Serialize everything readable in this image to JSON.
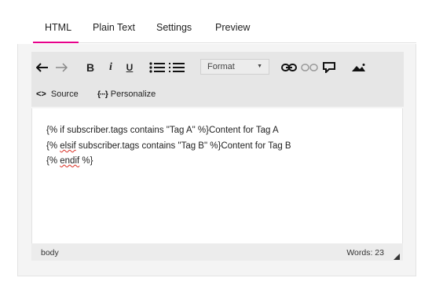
{
  "tabs": [
    {
      "label": "HTML"
    },
    {
      "label": "Plain Text"
    },
    {
      "label": "Settings"
    },
    {
      "label": "Preview"
    }
  ],
  "active_tab": "HTML",
  "accent_color": "#e6008a",
  "toolbar": {
    "bold_label": "B",
    "italic_label": "i",
    "underline_label": "U",
    "format_select": "Format",
    "source_label": "Source",
    "personalize_label": "Personalize",
    "source_icon": "<>",
    "personalize_icon": "{···}",
    "icons": [
      "undo-icon",
      "redo-icon",
      "bulleted-list-icon",
      "numbered-list-icon",
      "link-icon",
      "unlink-icon",
      "comment-icon",
      "image-icon"
    ]
  },
  "editor": {
    "line1": "{% if subscriber.tags contains \"Tag A\" %}Content for Tag A",
    "line2_prefix": "{% ",
    "line2_keyword": "elsif",
    "line2_rest": " subscriber.tags contains \"Tag B\" %}Content for Tag B",
    "line3_prefix": "{% ",
    "line3_keyword": "endif",
    "line3_rest": " %}"
  },
  "status": {
    "path": "body",
    "word_count": "Words: 23"
  }
}
